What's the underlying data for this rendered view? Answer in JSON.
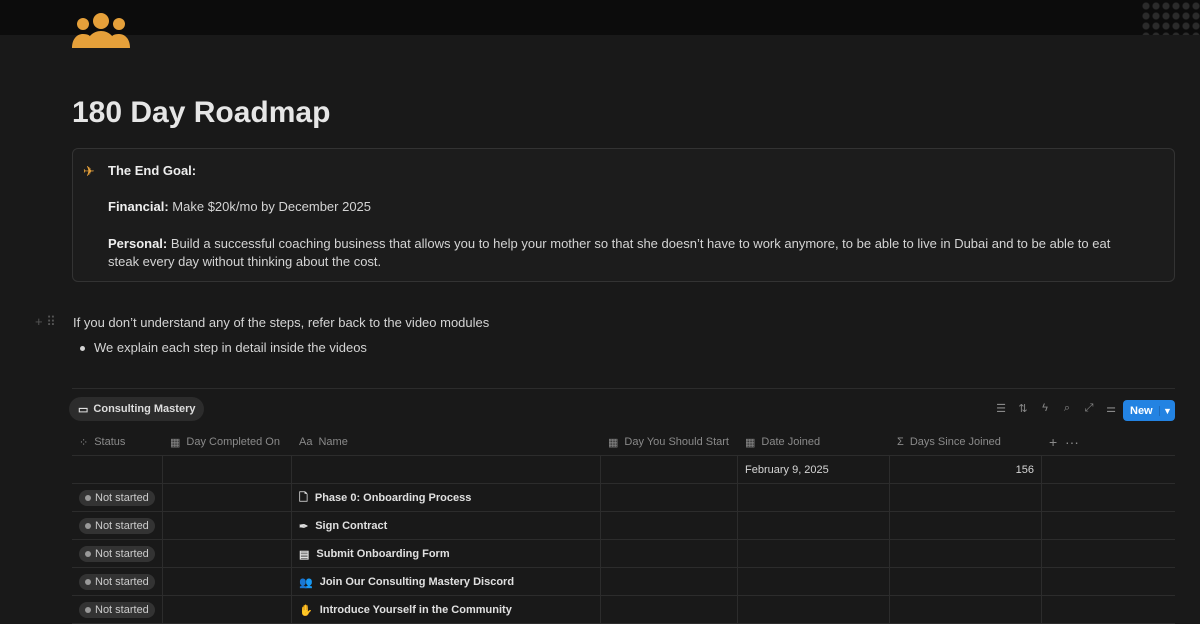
{
  "page": {
    "title": "180 Day Roadmap",
    "icon": "people-group-icon"
  },
  "callout": {
    "icon": "airplane-landing-icon",
    "heading": "The End Goal:",
    "financial_label": "Financial:",
    "financial_text": " Make $20k/mo by December 2025",
    "personal_label": "Personal:",
    "personal_text": " Build a successful coaching business that allows you to help your mother so that she doesn’t have to work anymore, to be able to live in Dubai and to be able to eat steak every day without thinking about the cost."
  },
  "note": "If you don’t understand any of the steps, refer back to the video modules",
  "bullet": "We explain each step in detail inside the videos",
  "database": {
    "view_tab": "Consulting Mastery",
    "new_label": "New",
    "columns": [
      {
        "icon": "status-icon",
        "label": "Status"
      },
      {
        "icon": "calendar-icon",
        "label": "Day Completed On"
      },
      {
        "icon": "text-icon",
        "label": "Name"
      },
      {
        "icon": "calendar-icon",
        "label": "Day You Should Start"
      },
      {
        "icon": "calendar-icon",
        "label": "Date Joined"
      },
      {
        "icon": "sigma-icon",
        "label": "Days Since Joined"
      }
    ],
    "summary_row": {
      "date_joined": "February 9, 2025",
      "days_since_joined": "156"
    },
    "rows": [
      {
        "status": "Not started",
        "icon": "page-icon",
        "name": "Phase 0: Onboarding Process"
      },
      {
        "status": "Not started",
        "icon": "pen-icon",
        "name": "Sign Contract"
      },
      {
        "status": "Not started",
        "icon": "document-icon",
        "name": "Submit Onboarding Form"
      },
      {
        "status": "Not started",
        "icon": "people-icon",
        "name": "Join Our Consulting Mastery Discord"
      },
      {
        "status": "Not started",
        "icon": "raised-hand-icon",
        "name": "Introduce Yourself in the Community"
      }
    ]
  },
  "colors": {
    "background": "#191919",
    "accent": "#2383e2",
    "icon": "#e5a03a"
  }
}
